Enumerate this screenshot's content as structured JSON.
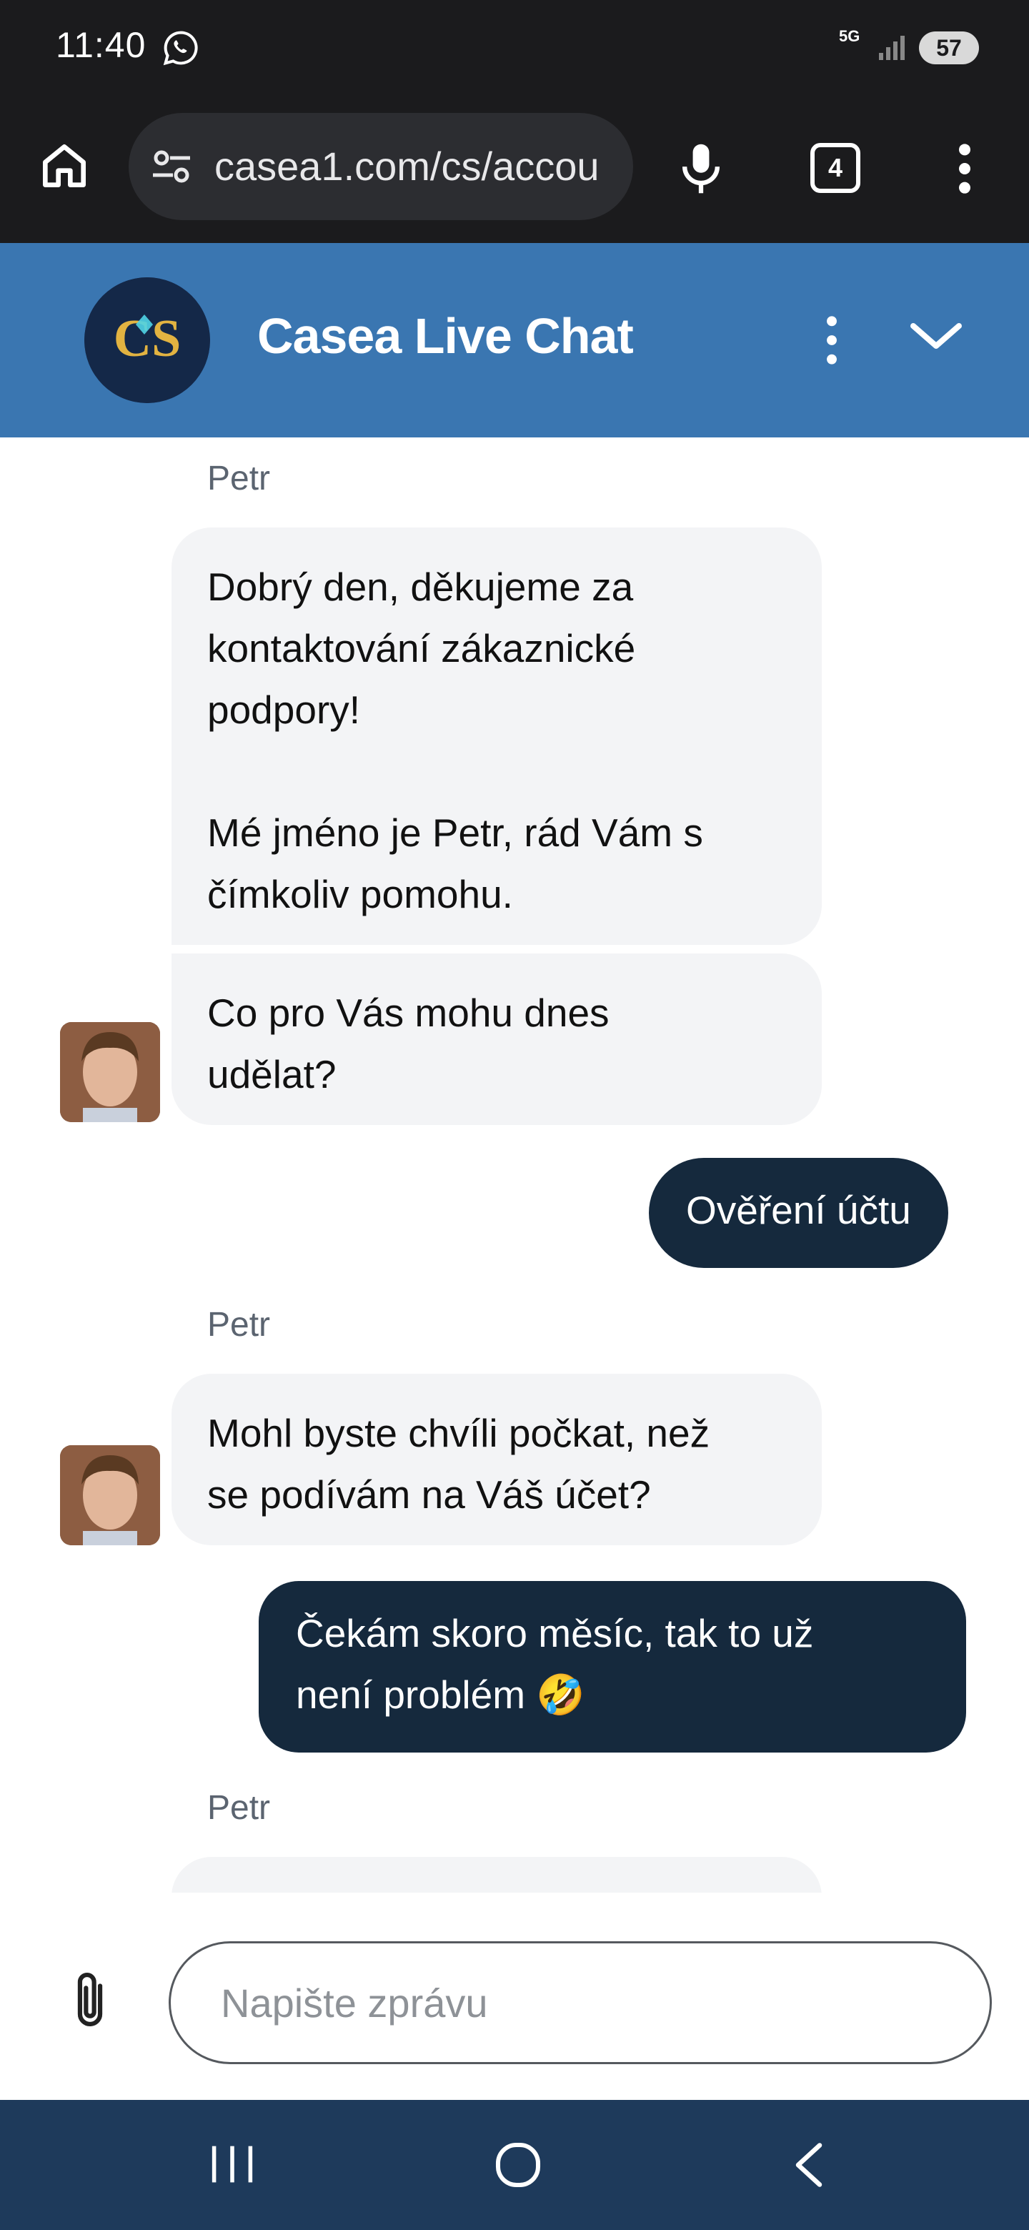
{
  "status_bar": {
    "time": "11:40",
    "network": "5G",
    "battery": "57"
  },
  "browser": {
    "url": "casea1.com/cs/accou",
    "tab_count": "4"
  },
  "chat": {
    "title": "Casea Live Chat",
    "logo_text": "CS",
    "messages": [
      {
        "sender": "Petr",
        "text": "Dobrý den, děkujeme za\nkontaktování zákaznické\npodpory!\n\nMé jméno je Petr, rád Vám s\nčímkoliv pomohu."
      },
      {
        "text": "Co pro Vás mohu dnes\nudělat?"
      },
      {
        "text": "Ověření účtu"
      },
      {
        "sender": "Petr",
        "text": "Mohl byste chvíli počkat, než\nse podívám na Váš účet?"
      },
      {
        "text": "Čekám skoro měsíc,  tak to už\nnení problém 🤣"
      },
      {
        "sender": "Petr"
      }
    ]
  },
  "composer": {
    "placeholder": "Napište zprávu"
  },
  "colors": {
    "header_bg": "#3a76b1",
    "agent_bubble": "#f3f4f6",
    "user_bubble": "#15293d",
    "nav_bar": "#1e3a5b"
  },
  "icons": [
    "whatsapp-icon",
    "signal-icon",
    "home-icon",
    "site-settings-icon",
    "mic-icon",
    "tabs-icon",
    "more-vert-icon",
    "chevron-down-icon",
    "paperclip-icon",
    "recents-icon",
    "nav-home-icon",
    "back-icon"
  ]
}
